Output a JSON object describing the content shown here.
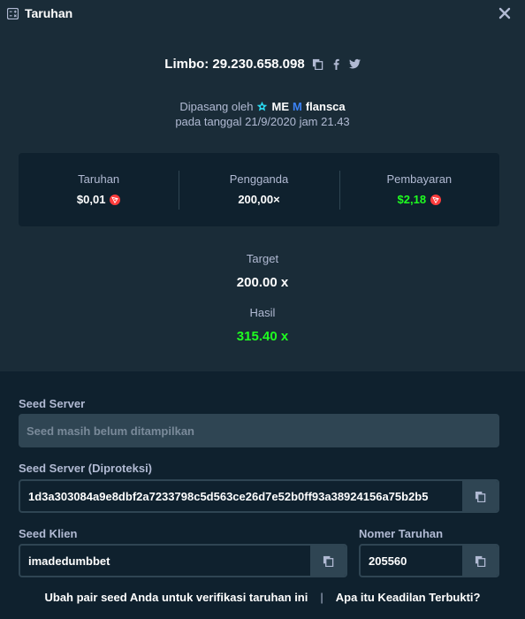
{
  "header": {
    "title": "Taruhan",
    "icon": "bets-icon",
    "close_icon": "close-icon"
  },
  "game": {
    "title": "Limbo: 29.230.658.098",
    "copy_icon": "copy-icon",
    "share": [
      "facebook-icon",
      "twitter-icon"
    ]
  },
  "placed": {
    "prefix": "Dipasang oleh",
    "badges": [
      "ME",
      "M"
    ],
    "user": "flansca",
    "date_line": "pada tanggal 21/9/2020 jam 21.43"
  },
  "stats": {
    "bet": {
      "label": "Taruhan",
      "value": "$0,01"
    },
    "multiplier": {
      "label": "Pengganda",
      "value": "200,00×"
    },
    "payout": {
      "label": "Pembayaran",
      "value": "$2,18"
    }
  },
  "target": {
    "label": "Target",
    "value": "200.00 x"
  },
  "result": {
    "label": "Hasil",
    "value": "315.40 x"
  },
  "seeds": {
    "server": {
      "label": "Seed Server",
      "placeholder": "Seed masih belum ditampilkan"
    },
    "server_hashed": {
      "label": "Seed Server (Diproteksi)",
      "value": "1d3a303084a9e8dbf2a7233798c5d563ce26d7e52b0ff93a38924156a75b2b5"
    },
    "client": {
      "label": "Seed Klien",
      "value": "imadedumbbet"
    },
    "nonce": {
      "label": "Nomer Taruhan",
      "value": "205560"
    }
  },
  "footer": {
    "change_seed": "Ubah pair seed Anda untuk verifikasi taruhan ini",
    "separator": "|",
    "provably_fair": "Apa itu Keadilan Terbukti?"
  },
  "colors": {
    "bg_top": "#1a2c38",
    "bg_bottom": "#0f212e",
    "green": "#1fff20",
    "coin_red": "#ff3b3b"
  }
}
